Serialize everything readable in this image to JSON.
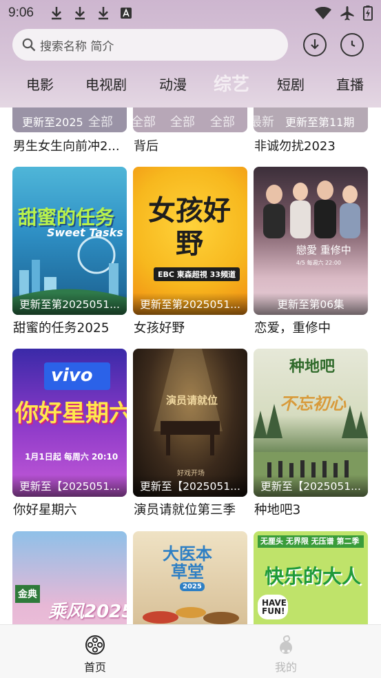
{
  "status_bar": {
    "time": "9:06"
  },
  "search": {
    "placeholder": "搜索名称 简介"
  },
  "tabs": [
    {
      "label": "电影"
    },
    {
      "label": "电视剧"
    },
    {
      "label": "动漫"
    },
    {
      "label": "综艺"
    },
    {
      "label": "短剧"
    },
    {
      "label": "直播"
    }
  ],
  "active_tab": "综艺",
  "filter_strip": {
    "badges": [
      "更新至2025",
      "最新",
      "更新至第11期"
    ],
    "filters": [
      "全部",
      "全部",
      "全部",
      "全部"
    ]
  },
  "partial_row": {
    "titles": [
      "男生女生向前冲2...",
      "背后",
      "非诚勿扰2023"
    ]
  },
  "cards": [
    {
      "title": "甜蜜的任务2025",
      "badge": "更新至第2025051...",
      "poster_text": "甜蜜的任务",
      "poster_sub": "Sweet Tasks"
    },
    {
      "title": "女孩好野",
      "badge": "更新至第2025051...",
      "poster_text": "女孩好野",
      "poster_sub": "EBC 東森超視 33頻道"
    },
    {
      "title": "恋爱，重修中",
      "badge": "更新至第06集",
      "poster_text": "戀愛 重修中",
      "poster_sub": "4/5 每週六 22:00"
    },
    {
      "title": "你好星期六",
      "badge": "更新至【2025051...",
      "poster_text": "你好星期六",
      "poster_sub": "vivo",
      "poster_extra": "1月1日起 每周六 20:10"
    },
    {
      "title": "演员请就位第三季",
      "badge": "更新至【2025051...",
      "poster_text": "演员请就位",
      "poster_sub": "好戏开场"
    },
    {
      "title": "种地吧3",
      "badge": "更新至【2025051...",
      "poster_text": "种地吧",
      "poster_sub": "不忘初心"
    },
    {
      "title": "",
      "badge": "",
      "poster_text": "乘风2025",
      "poster_sub": "金典"
    },
    {
      "title": "",
      "badge": "",
      "poster_text": "大医本草堂",
      "poster_sub": "2025"
    },
    {
      "title": "",
      "badge": "",
      "poster_text": "快乐的大人",
      "poster_sub": "HAVE FUN!",
      "poster_extra": "无厘头 无界限 无压谱 第二季"
    }
  ],
  "bottom_nav": {
    "items": [
      {
        "label": "首页",
        "icon": "film-reel-icon",
        "active": true
      },
      {
        "label": "我的",
        "icon": "profile-icon",
        "active": false
      }
    ]
  },
  "colors": {
    "header_bg": "#cdb6cf",
    "active_tab": "#f4eef3",
    "inactive_nav": "#b8b8b8"
  }
}
